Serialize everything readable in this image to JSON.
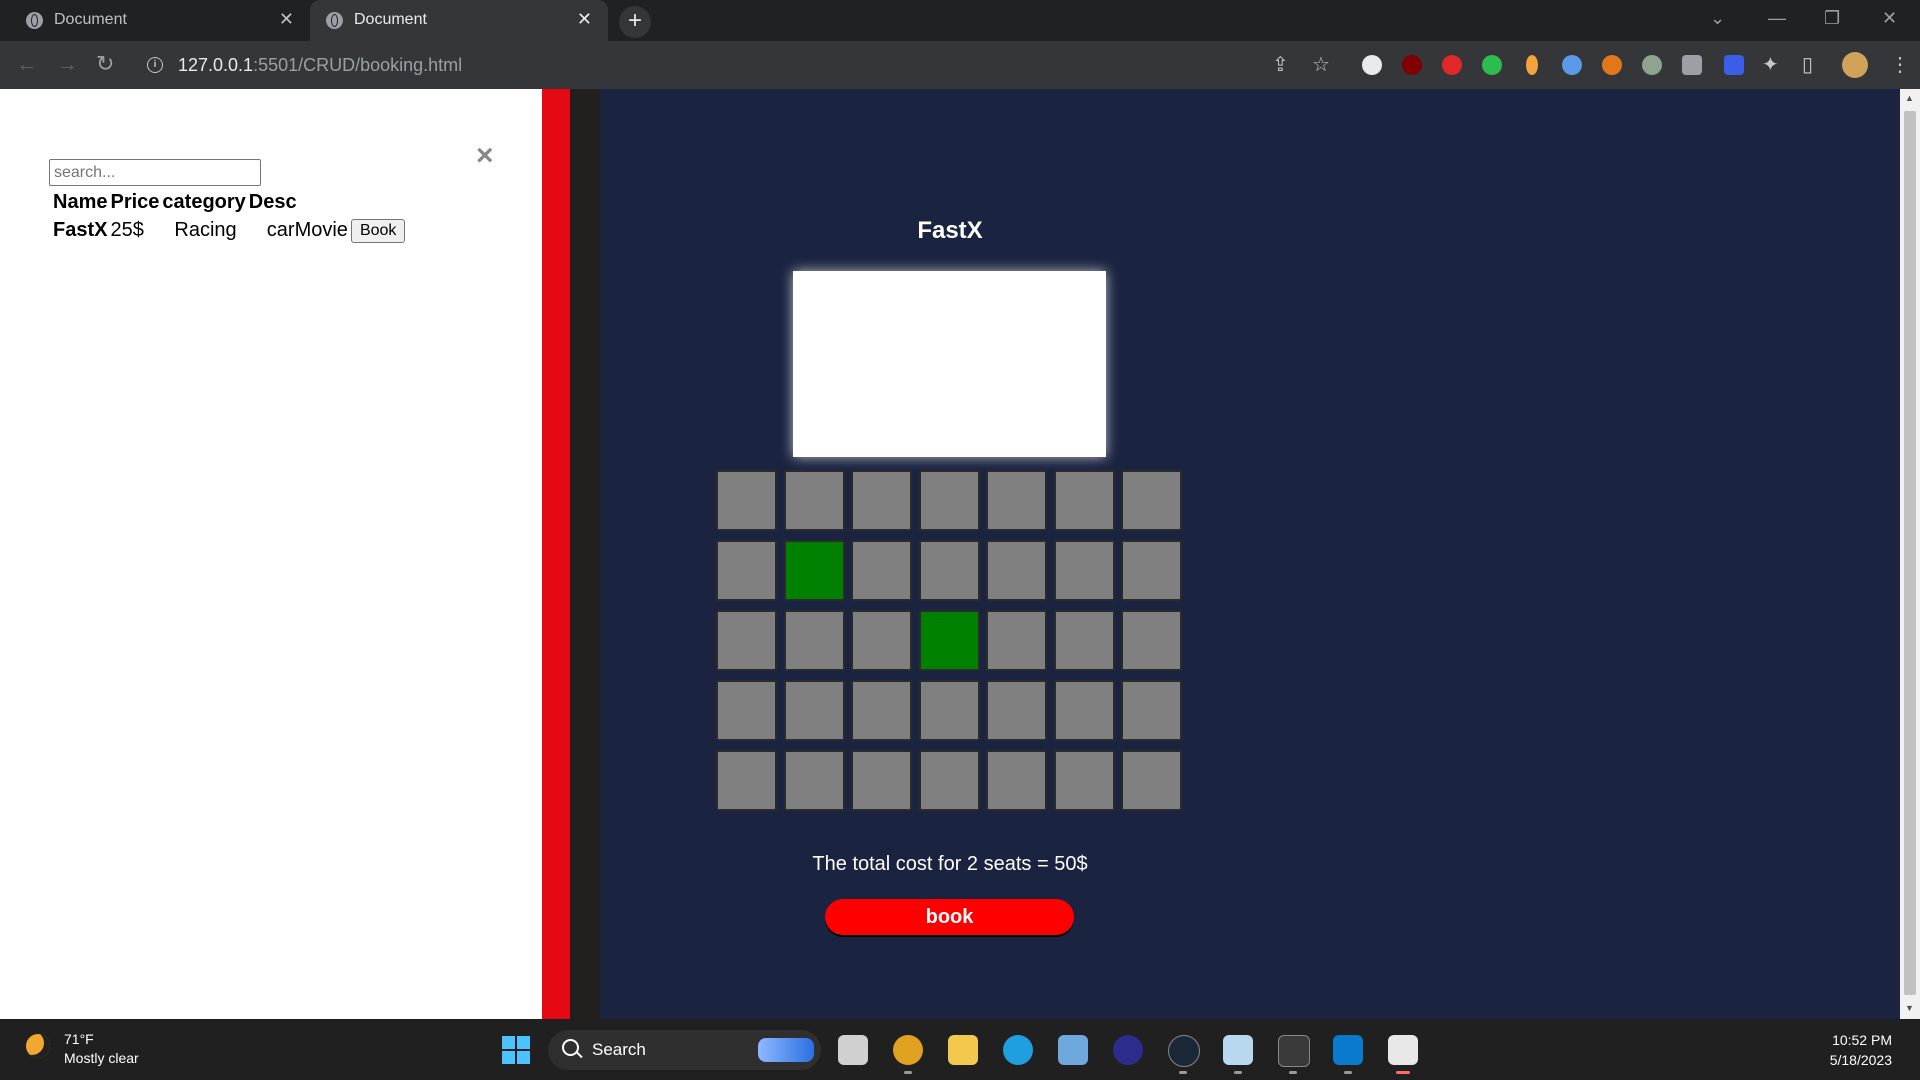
{
  "browser": {
    "tabs": [
      {
        "title": "Document",
        "close": "✕"
      },
      {
        "title": "Document",
        "close": "✕"
      }
    ],
    "new_tab": "+",
    "url_host": "127.0.0.1",
    "url_path": ":5501/CRUD/booking.html"
  },
  "sidebar": {
    "search_placeholder": "search...",
    "close": "×",
    "columns": [
      "Name",
      "Price",
      "category",
      "Desc"
    ],
    "movies": [
      {
        "name": "FastX",
        "price": "25$",
        "category": "Racing",
        "desc": "carMovie",
        "action": "Book"
      }
    ]
  },
  "booking": {
    "movie_title": "FastX",
    "seat_rows": [
      [
        false,
        false,
        false,
        false,
        false,
        false,
        false
      ],
      [
        false,
        true,
        false,
        false,
        false,
        false,
        false
      ],
      [
        false,
        false,
        false,
        true,
        false,
        false,
        false
      ],
      [
        false,
        false,
        false,
        false,
        false,
        false,
        false
      ],
      [
        false,
        false,
        false,
        false,
        false,
        false,
        false
      ]
    ],
    "total_text": "The total cost for 2 seats = 50$",
    "book_label": "book",
    "colors": {
      "seat": "#808080",
      "selected": "#008000",
      "accent": "#e50914",
      "background": "#1a2340"
    }
  },
  "taskbar": {
    "temperature": "71°F",
    "condition": "Mostly clear",
    "search_label": "Search",
    "time": "10:52 PM",
    "date": "5/18/2023"
  }
}
